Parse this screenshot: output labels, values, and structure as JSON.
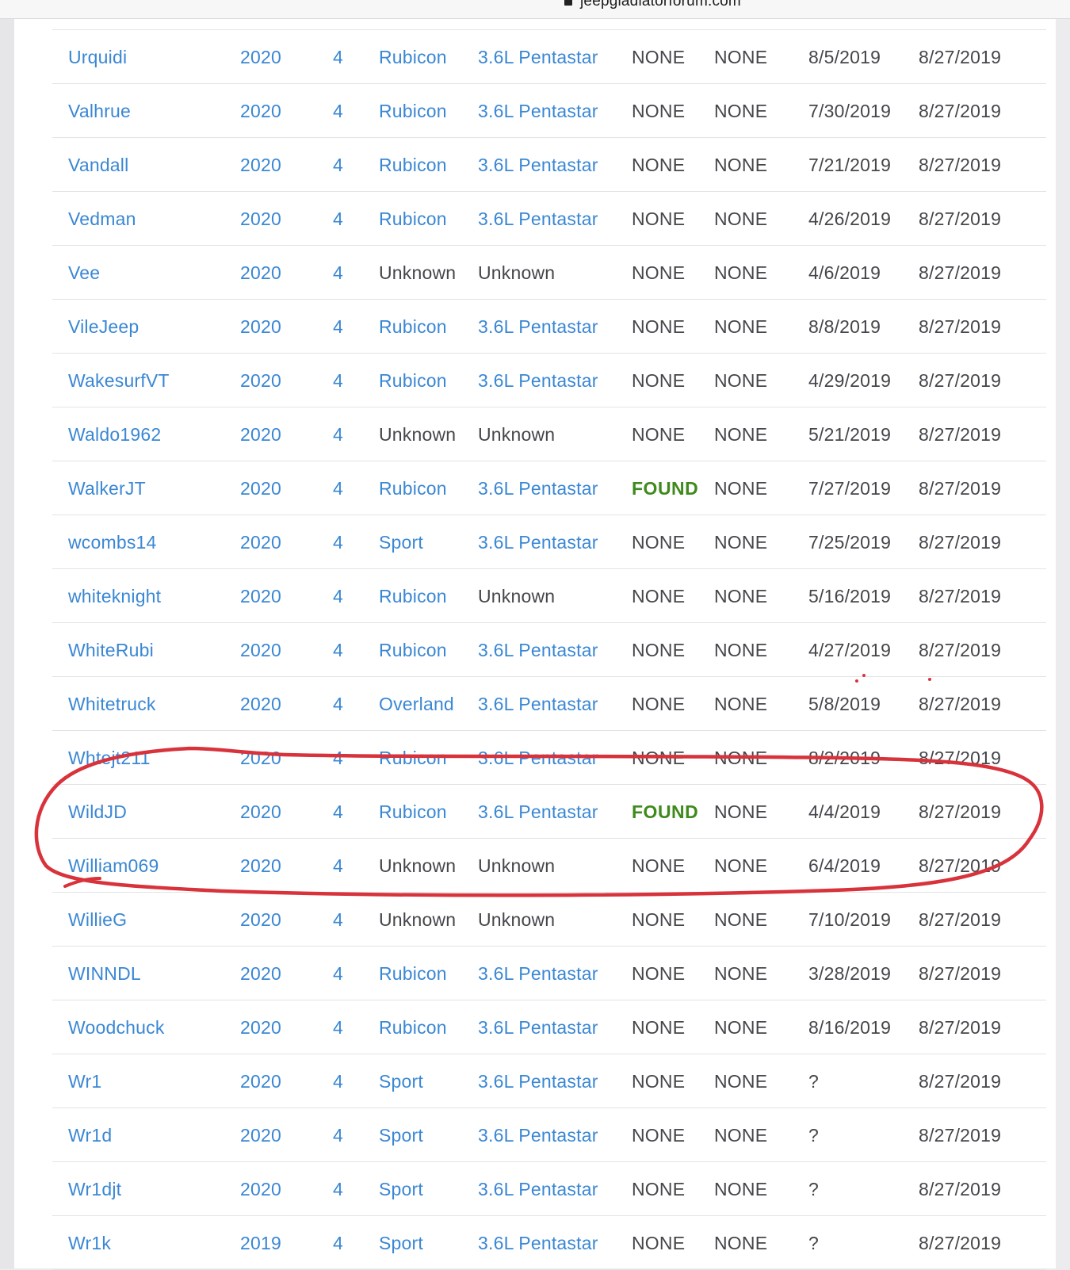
{
  "browser": {
    "url": "jeepgladiatorforum.com"
  },
  "table": {
    "rows": [
      {
        "user": "Urquidi",
        "year": "2020",
        "doors": "4",
        "trim": "Rubicon",
        "engine": "3.6L Pentastar",
        "status1": "NONE",
        "status2": "NONE",
        "date1": "8/5/2019",
        "date2": "8/27/2019"
      },
      {
        "user": "Valhrue",
        "year": "2020",
        "doors": "4",
        "trim": "Rubicon",
        "engine": "3.6L Pentastar",
        "status1": "NONE",
        "status2": "NONE",
        "date1": "7/30/2019",
        "date2": "8/27/2019"
      },
      {
        "user": "Vandall",
        "year": "2020",
        "doors": "4",
        "trim": "Rubicon",
        "engine": "3.6L Pentastar",
        "status1": "NONE",
        "status2": "NONE",
        "date1": "7/21/2019",
        "date2": "8/27/2019"
      },
      {
        "user": "Vedman",
        "year": "2020",
        "doors": "4",
        "trim": "Rubicon",
        "engine": "3.6L Pentastar",
        "status1": "NONE",
        "status2": "NONE",
        "date1": "4/26/2019",
        "date2": "8/27/2019"
      },
      {
        "user": "Vee",
        "year": "2020",
        "doors": "4",
        "trim": "Unknown",
        "engine": "Unknown",
        "status1": "NONE",
        "status2": "NONE",
        "date1": "4/6/2019",
        "date2": "8/27/2019"
      },
      {
        "user": "VileJeep",
        "year": "2020",
        "doors": "4",
        "trim": "Rubicon",
        "engine": "3.6L Pentastar",
        "status1": "NONE",
        "status2": "NONE",
        "date1": "8/8/2019",
        "date2": "8/27/2019"
      },
      {
        "user": "WakesurfVT",
        "year": "2020",
        "doors": "4",
        "trim": "Rubicon",
        "engine": "3.6L Pentastar",
        "status1": "NONE",
        "status2": "NONE",
        "date1": "4/29/2019",
        "date2": "8/27/2019"
      },
      {
        "user": "Waldo1962",
        "year": "2020",
        "doors": "4",
        "trim": "Unknown",
        "engine": "Unknown",
        "status1": "NONE",
        "status2": "NONE",
        "date1": "5/21/2019",
        "date2": "8/27/2019"
      },
      {
        "user": "WalkerJT",
        "year": "2020",
        "doors": "4",
        "trim": "Rubicon",
        "engine": "3.6L Pentastar",
        "status1": "FOUND",
        "status2": "NONE",
        "date1": "7/27/2019",
        "date2": "8/27/2019"
      },
      {
        "user": "wcombs14",
        "year": "2020",
        "doors": "4",
        "trim": "Sport",
        "engine": "3.6L Pentastar",
        "status1": "NONE",
        "status2": "NONE",
        "date1": "7/25/2019",
        "date2": "8/27/2019"
      },
      {
        "user": "whiteknight",
        "year": "2020",
        "doors": "4",
        "trim": "Rubicon",
        "engine": "Unknown",
        "status1": "NONE",
        "status2": "NONE",
        "date1": "5/16/2019",
        "date2": "8/27/2019"
      },
      {
        "user": "WhiteRubi",
        "year": "2020",
        "doors": "4",
        "trim": "Rubicon",
        "engine": "3.6L Pentastar",
        "status1": "NONE",
        "status2": "NONE",
        "date1": "4/27/2019",
        "date2": "8/27/2019"
      },
      {
        "user": "Whitetruck",
        "year": "2020",
        "doors": "4",
        "trim": "Overland",
        "engine": "3.6L Pentastar",
        "status1": "NONE",
        "status2": "NONE",
        "date1": "5/8/2019",
        "date2": "8/27/2019"
      },
      {
        "user": "Whtejt211",
        "year": "2020",
        "doors": "4",
        "trim": "Rubicon",
        "engine": "3.6L Pentastar",
        "status1": "NONE",
        "status2": "NONE",
        "date1": "8/2/2019",
        "date2": "8/27/2019"
      },
      {
        "user": "WildJD",
        "year": "2020",
        "doors": "4",
        "trim": "Rubicon",
        "engine": "3.6L Pentastar",
        "status1": "FOUND",
        "status2": "NONE",
        "date1": "4/4/2019",
        "date2": "8/27/2019"
      },
      {
        "user": "William069",
        "year": "2020",
        "doors": "4",
        "trim": "Unknown",
        "engine": "Unknown",
        "status1": "NONE",
        "status2": "NONE",
        "date1": "6/4/2019",
        "date2": "8/27/2019"
      },
      {
        "user": "WillieG",
        "year": "2020",
        "doors": "4",
        "trim": "Unknown",
        "engine": "Unknown",
        "status1": "NONE",
        "status2": "NONE",
        "date1": "7/10/2019",
        "date2": "8/27/2019"
      },
      {
        "user": "WINNDL",
        "year": "2020",
        "doors": "4",
        "trim": "Rubicon",
        "engine": "3.6L Pentastar",
        "status1": "NONE",
        "status2": "NONE",
        "date1": "3/28/2019",
        "date2": "8/27/2019"
      },
      {
        "user": "Woodchuck",
        "year": "2020",
        "doors": "4",
        "trim": "Rubicon",
        "engine": "3.6L Pentastar",
        "status1": "NONE",
        "status2": "NONE",
        "date1": "8/16/2019",
        "date2": "8/27/2019"
      },
      {
        "user": "Wr1",
        "year": "2020",
        "doors": "4",
        "trim": "Sport",
        "engine": "3.6L Pentastar",
        "status1": "NONE",
        "status2": "NONE",
        "date1": "?",
        "date2": "8/27/2019"
      },
      {
        "user": "Wr1d",
        "year": "2020",
        "doors": "4",
        "trim": "Sport",
        "engine": "3.6L Pentastar",
        "status1": "NONE",
        "status2": "NONE",
        "date1": "?",
        "date2": "8/27/2019"
      },
      {
        "user": "Wr1djt",
        "year": "2020",
        "doors": "4",
        "trim": "Sport",
        "engine": "3.6L Pentastar",
        "status1": "NONE",
        "status2": "NONE",
        "date1": "?",
        "date2": "8/27/2019"
      },
      {
        "user": "Wr1k",
        "year": "2019",
        "doors": "4",
        "trim": "Sport",
        "engine": "3.6L Pentastar",
        "status1": "NONE",
        "status2": "NONE",
        "date1": "?",
        "date2": "8/27/2019"
      }
    ]
  },
  "colors": {
    "link": "#3a87d4",
    "plain": "#45454b",
    "found": "#3e8a1c",
    "annotation": "#d8323b"
  }
}
